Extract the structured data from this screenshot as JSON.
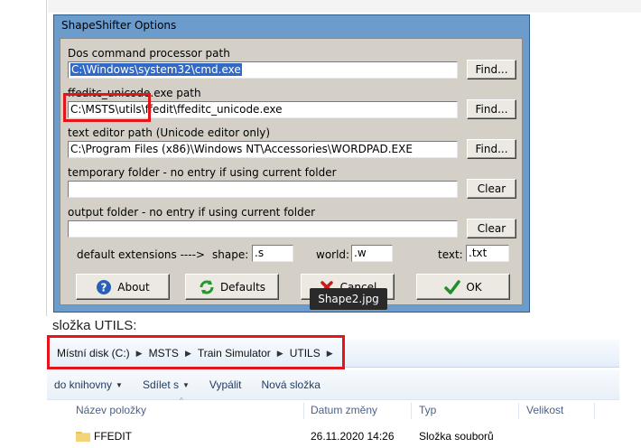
{
  "dialog": {
    "title": "ShapeShifter Options",
    "dos_label": "Dos command processor path",
    "dos_value": "C:\\Windows\\system32\\cmd.exe",
    "ffeditc_label": "ffeditc_unicode.exe path",
    "ffeditc_value": "C:\\MSTS\\utils\\ffedit\\ffeditc_unicode.exe",
    "editor_label": "text editor path  (Unicode editor only)",
    "editor_value": "C:\\Program Files (x86)\\Windows NT\\Accessories\\WORDPAD.EXE",
    "temp_label": "temporary folder - no entry if using current folder",
    "temp_value": "",
    "output_label": "output folder - no entry if using current folder",
    "output_value": "",
    "find_label": "Find...",
    "clear_label": "Clear",
    "ext_label": "default extensions ---->",
    "shape_label": "shape:",
    "shape_value": ".s",
    "world_label": "world:",
    "world_value": ".w",
    "text_label": "text:",
    "text_value": ".txt",
    "about_label": "About",
    "defaults_label": "Defaults",
    "cancel_label": "Cancel",
    "ok_label": "OK"
  },
  "tooltip": "Shape2.jpg",
  "caption": "složka UTILS:",
  "explorer": {
    "breadcrumb": [
      "Místní disk (C:)",
      "MSTS",
      "Train Simulator",
      "UTILS"
    ],
    "toolbar": [
      {
        "label": "do knihovny",
        "dropdown": true
      },
      {
        "label": "Sdílet s",
        "dropdown": true
      },
      {
        "label": "Vypálit",
        "dropdown": false
      },
      {
        "label": "Nová složka",
        "dropdown": false
      }
    ],
    "columns": [
      "Název položky",
      "Datum změny",
      "Typ",
      "Velikost"
    ],
    "rows": [
      {
        "name": "FFEDIT",
        "date": "26.11.2020 14:26",
        "type": "Složka souborů",
        "size": ""
      }
    ]
  },
  "colors": {
    "highlight_box": "#e4141b",
    "title_bar": "#6c9ccb",
    "selection": "#3169c6"
  }
}
